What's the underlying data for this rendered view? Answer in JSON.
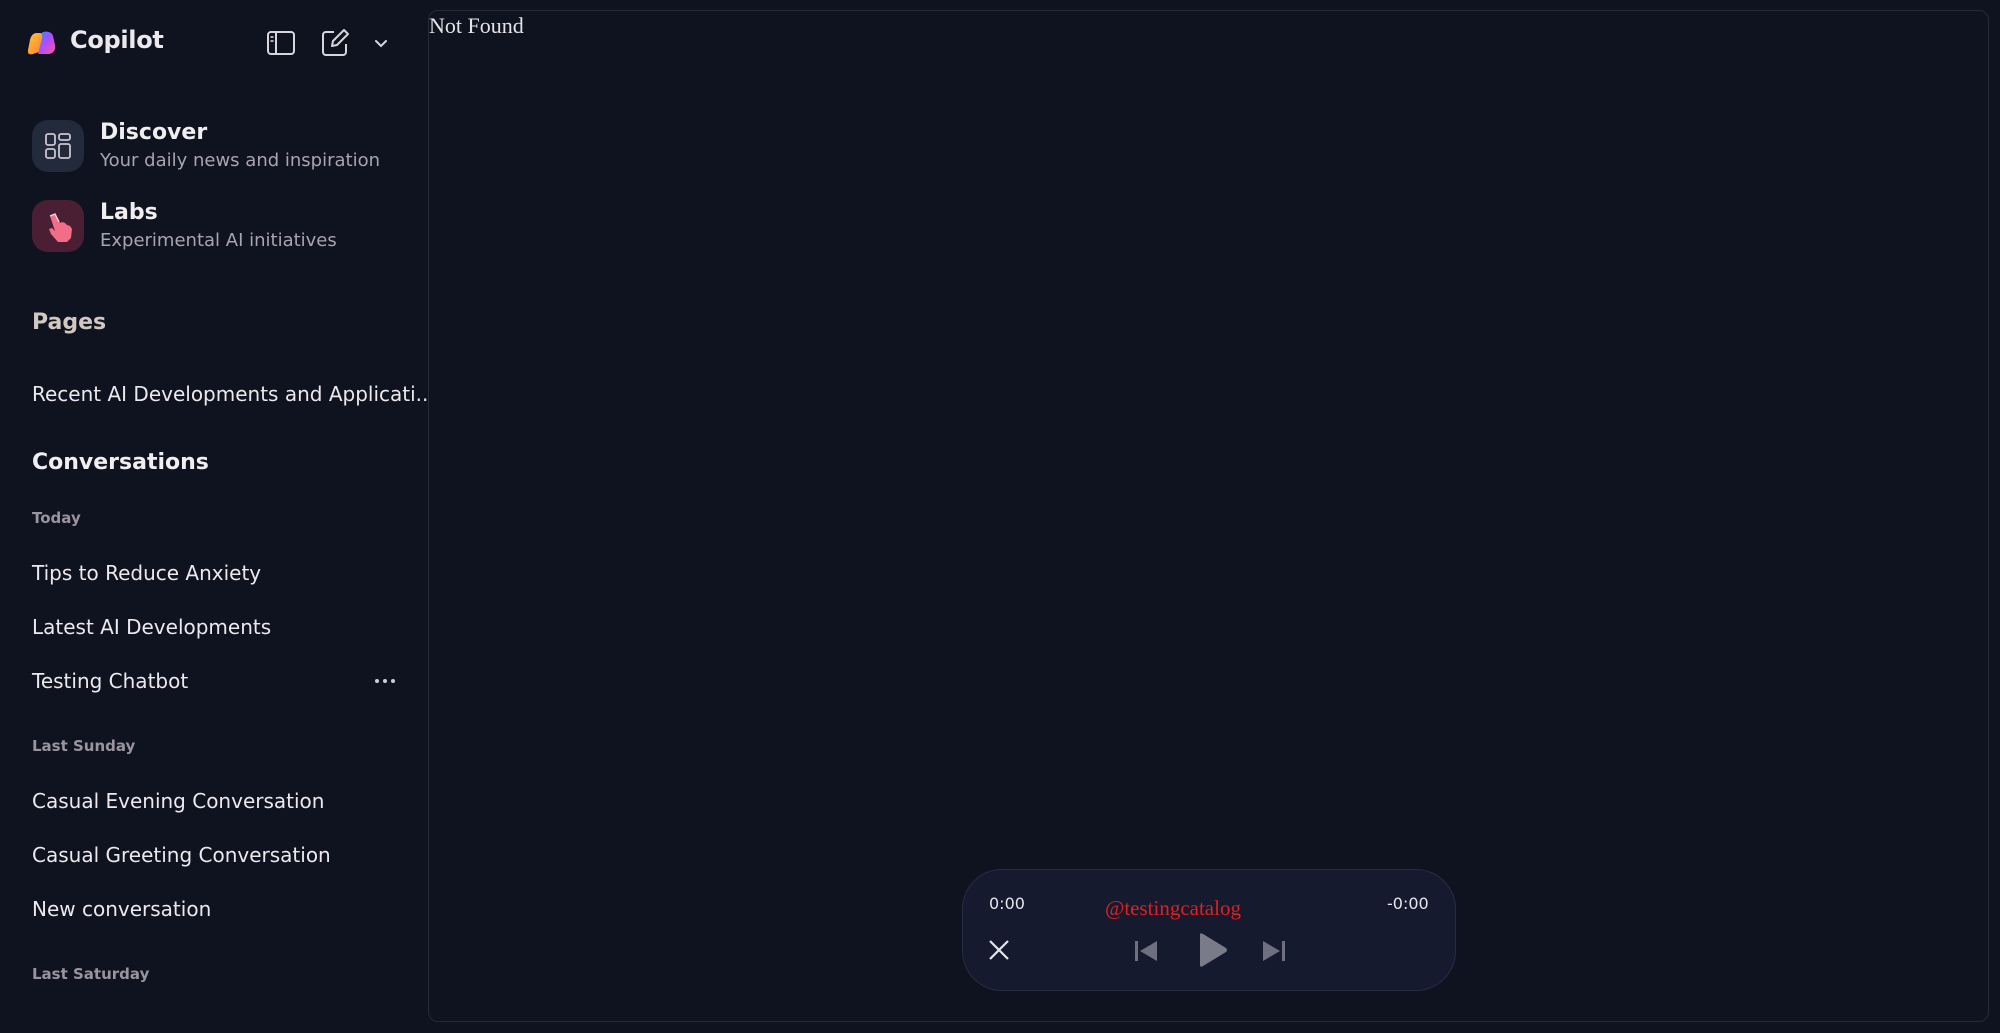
{
  "app": {
    "name": "Copilot"
  },
  "toolbar": {
    "sidebar_toggle_icon": "sidebar-panel-icon",
    "new_chat_icon": "compose-icon",
    "dropdown_icon": "chevron-down-icon"
  },
  "features": [
    {
      "title": "Discover",
      "subtitle": "Your daily news and inspiration",
      "icon": "grid-icon"
    },
    {
      "title": "Labs",
      "subtitle": "Experimental AI initiatives",
      "icon": "pointer-hand-icon"
    }
  ],
  "pages": {
    "heading": "Pages",
    "items": [
      "Recent AI Developments and Applicati..."
    ]
  },
  "conversations": {
    "heading": "Conversations",
    "groups": [
      {
        "label": "Today",
        "items": [
          "Tips to Reduce Anxiety",
          "Latest AI Developments",
          "Testing Chatbot"
        ]
      },
      {
        "label": "Last Sunday",
        "items": [
          "Casual Evening Conversation",
          "Casual Greeting Conversation",
          "New conversation"
        ]
      },
      {
        "label": "Last Saturday",
        "items": []
      }
    ]
  },
  "main": {
    "message": "Not Found"
  },
  "player": {
    "elapsed": "0:00",
    "remaining": "-0:00",
    "watermark": "@testingcatalog"
  },
  "colors": {
    "background": "#0f1320",
    "player_bg": "#151a2e",
    "watermark": "#e02020",
    "labs_icon_bg": "#4a1f33",
    "discover_icon_bg": "#222a3b"
  }
}
